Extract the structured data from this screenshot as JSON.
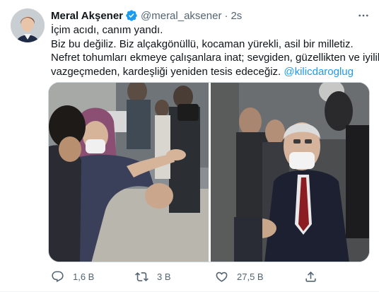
{
  "tweet": {
    "author_name": "Meral Akşener",
    "handle": "@meral_aksener",
    "separator": "·",
    "time": "2s",
    "text_lines": [
      "İçim acıdı, canım yandı.",
      "Biz bu değiliz. Biz alçakgönüllü, kocaman yürekli, asil bir milletiz.",
      "Nefret tohumları ekmeye çalışanlara inat; sevgiden, güzellikten ve iyilikten",
      "vazgeçmeden, kardeşliği yeniden tesis edeceğiz."
    ],
    "mention": "@kilicdaroglug"
  },
  "actions": {
    "reply_count": "1,6 B",
    "retweet_count": "3 B",
    "like_count": "27,5 B"
  },
  "icons": {
    "verified": "verified-badge-icon",
    "more": "more-icon",
    "reply": "reply-icon",
    "retweet": "retweet-icon",
    "like": "like-icon",
    "share": "share-icon"
  },
  "colors": {
    "accent": "#1d9bf0",
    "text": "#0f1419",
    "secondary": "#536471",
    "border": "#cfd9de"
  }
}
